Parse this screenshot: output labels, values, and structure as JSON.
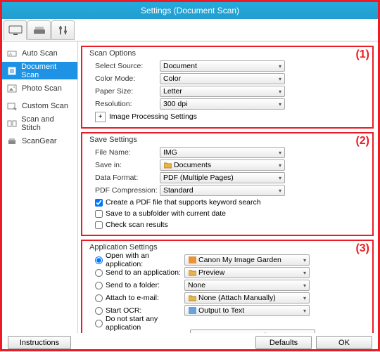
{
  "window": {
    "title": "Settings (Document Scan)"
  },
  "annotations": {
    "g1": "(1)",
    "g2": "(2)",
    "g3": "(3)"
  },
  "sidebar": {
    "items": [
      {
        "label": "Auto Scan"
      },
      {
        "label": "Document Scan"
      },
      {
        "label": "Photo Scan"
      },
      {
        "label": "Custom Scan"
      },
      {
        "label": "Scan and Stitch"
      },
      {
        "label": "ScanGear"
      }
    ]
  },
  "scan": {
    "title": "Scan Options",
    "select_source": {
      "label": "Select Source:",
      "value": "Document"
    },
    "color_mode": {
      "label": "Color Mode:",
      "value": "Color"
    },
    "paper_size": {
      "label": "Paper Size:",
      "value": "Letter"
    },
    "resolution": {
      "label": "Resolution:",
      "value": "300 dpi"
    },
    "imgproc": "Image Processing Settings"
  },
  "save": {
    "title": "Save Settings",
    "file_name": {
      "label": "File Name:",
      "value": "IMG"
    },
    "save_in": {
      "label": "Save in:",
      "value": "Documents"
    },
    "data_format": {
      "label": "Data Format:",
      "value": "PDF (Multiple Pages)"
    },
    "pdf_comp": {
      "label": "PDF Compression:",
      "value": "Standard"
    },
    "ck_keyword": "Create a PDF file that supports keyword search",
    "ck_subfolder": "Save to a subfolder with current date",
    "ck_results": "Check scan results"
  },
  "app": {
    "title": "Application Settings",
    "open_app": {
      "label": "Open with an application:",
      "value": "Canon My Image Garden"
    },
    "send_app": {
      "label": "Send to an application:",
      "value": "Preview"
    },
    "send_folder": {
      "label": "Send to a folder:",
      "value": "None"
    },
    "attach_email": {
      "label": "Attach to e-mail:",
      "value": "None (Attach Manually)"
    },
    "start_ocr": {
      "label": "Start OCR:",
      "value": "Output to Text"
    },
    "no_start": "Do not start any application",
    "more_fn": "More Functions"
  },
  "buttons": {
    "instructions": "Instructions",
    "defaults": "Defaults",
    "ok": "OK"
  }
}
